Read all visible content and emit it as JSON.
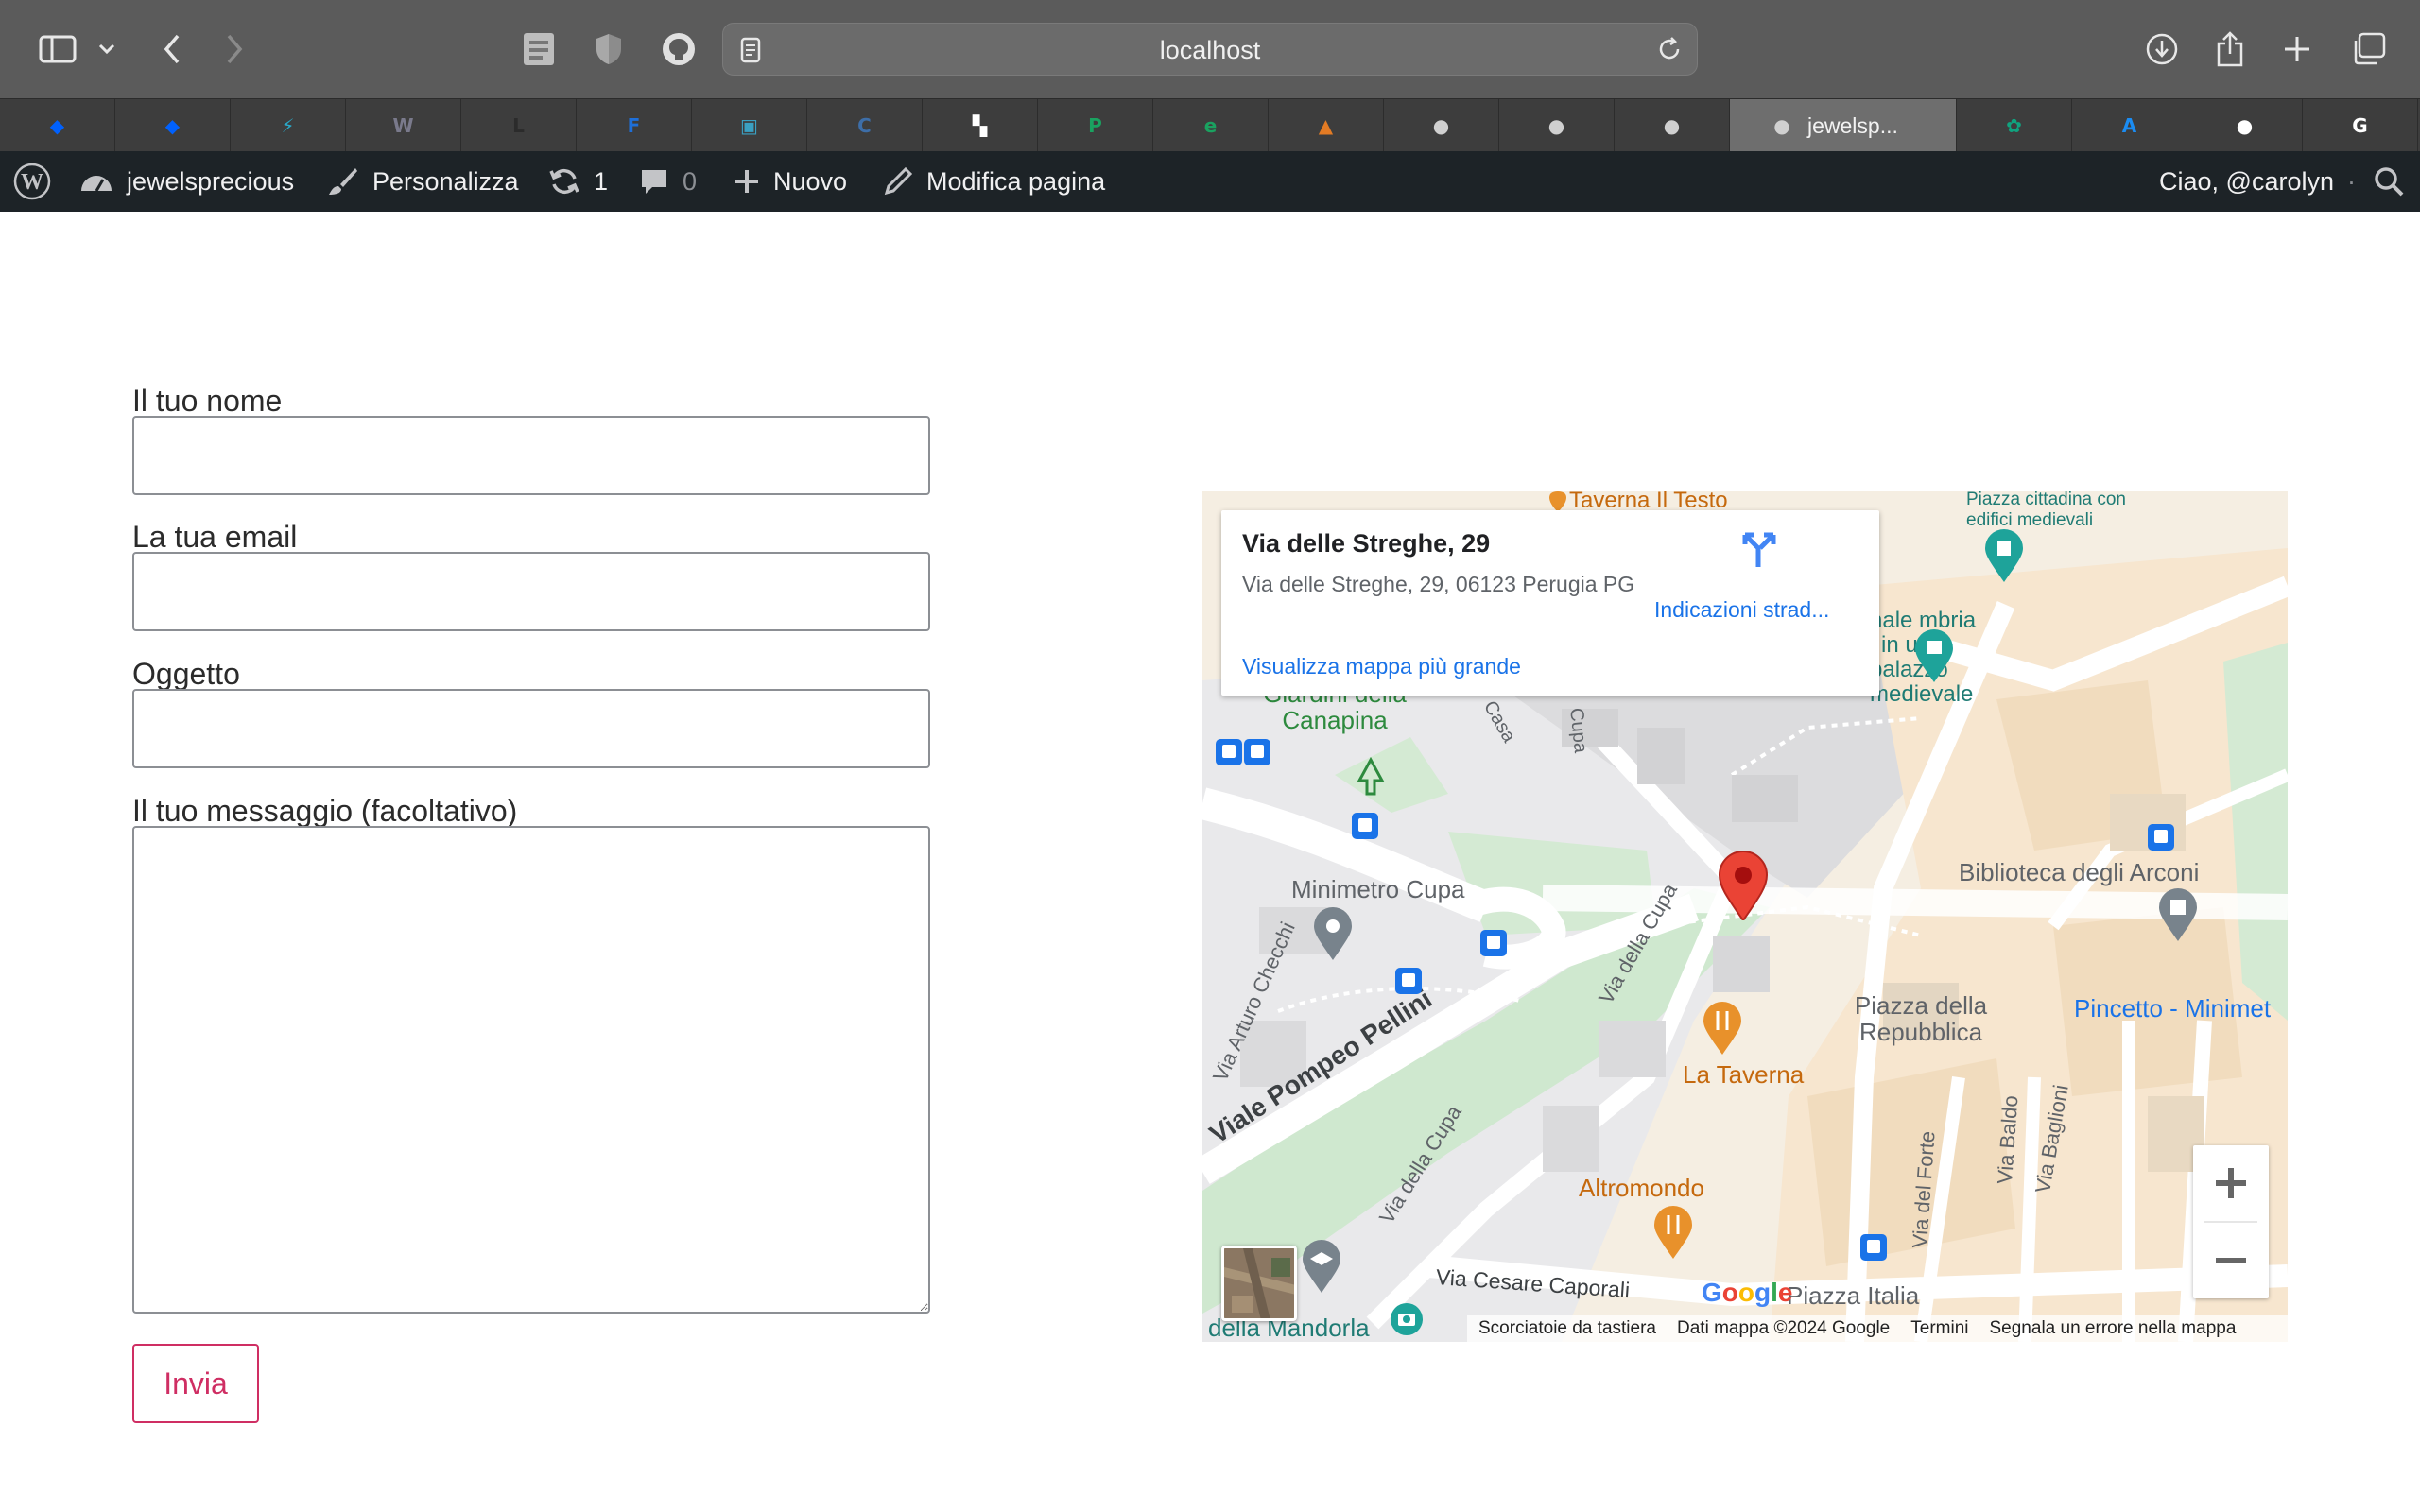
{
  "browser": {
    "address": "localhost"
  },
  "tabs": [
    {
      "icon": "dropbox-icon",
      "color": "#0061fe"
    },
    {
      "icon": "dropbox-icon",
      "color": "#0061fe"
    },
    {
      "icon": "bolt-icon",
      "color": "#2aa9c9"
    },
    {
      "icon": "w-icon",
      "color": "#7a7a8c"
    },
    {
      "icon": "l-icon",
      "color": "#2b2b2b"
    },
    {
      "icon": "f-icon",
      "color": "#1e6fd9"
    },
    {
      "icon": "tablet-icon",
      "color": "#3aa0c2"
    },
    {
      "icon": "c-icon",
      "color": "#3d6ea8"
    },
    {
      "icon": "checker-icon",
      "color": "#ffffff"
    },
    {
      "icon": "p-icon",
      "color": "#1aa260"
    },
    {
      "icon": "e-icon",
      "color": "#1aa260"
    },
    {
      "icon": "pyramid-icon",
      "color": "#e37b24"
    },
    {
      "icon": "elephant-icon",
      "color": "#d0d0d0"
    },
    {
      "icon": "elephant-icon",
      "color": "#d0d0d0"
    },
    {
      "icon": "elephant-icon",
      "color": "#d0d0d0"
    },
    {
      "icon": "elephant-icon",
      "color": "#d0d0d0",
      "title": "jewelsp...",
      "active": true
    },
    {
      "icon": "openai-icon",
      "color": "#10a37f"
    },
    {
      "icon": "appstore-icon",
      "color": "#1b8cf2"
    },
    {
      "icon": "github-icon",
      "color": "#ffffff"
    },
    {
      "icon": "google-icon",
      "color": "#ffffff"
    }
  ],
  "admin_bar": {
    "site": "jewelsprecious",
    "customize": "Personalizza",
    "updates": "1",
    "comments": "0",
    "new": "Nuovo",
    "edit": "Modifica pagina",
    "greeting": "Ciao, @carolyn"
  },
  "form": {
    "name_label": "Il tuo nome",
    "email_label": "La tua email",
    "subject_label": "Oggetto",
    "message_label": "Il tuo messaggio (facoltativo)",
    "submit": "Invia",
    "accent": "#cf2e63"
  },
  "map": {
    "card": {
      "title": "Via delle Streghe, 29",
      "address": "Via delle Streghe, 29, 06123 Perugia PG",
      "larger_map": "Visualizza mappa più grande",
      "directions": "Indicazioni strad..."
    },
    "labels": {
      "taverna": "Taverna Il Testo",
      "piazza_cittadina": "Piazza cittadina con edifici medievali",
      "galleria": "nale mbria i in un palazzo medievale",
      "giardini": "Giardini della Canapina",
      "minimetro": "Minimetro Cupa",
      "biblioteca": "Biblioteca degli Arconi",
      "piazza_repubblica": "Piazza della Repubblica",
      "pincetto": "Pincetto - Minimet",
      "la_taverna": "La Taverna",
      "altromondo": "Altromondo",
      "pompeo": "Viale Pompeo Pellini",
      "arturo": "Via Arturo Checchi",
      "cupa1": "Via della Cupa",
      "cupa2": "Via della Cupa",
      "cesare": "Via Cesare Caporali",
      "piazza_italia": "Piazza Italia",
      "mandorla": "della Mandorla",
      "forte": "Via del Forte",
      "baldo": "Via Baldo",
      "baglioni": "Via Baglioni",
      "casa": "Casa",
      "cupa_short": "Cupa"
    },
    "footer": {
      "shortcuts": "Scorciatoie da tastiera",
      "data": "Dati mappa ©2024 Google",
      "terms": "Termini",
      "report": "Segnala un errore nella mappa"
    },
    "logo": "Google"
  }
}
